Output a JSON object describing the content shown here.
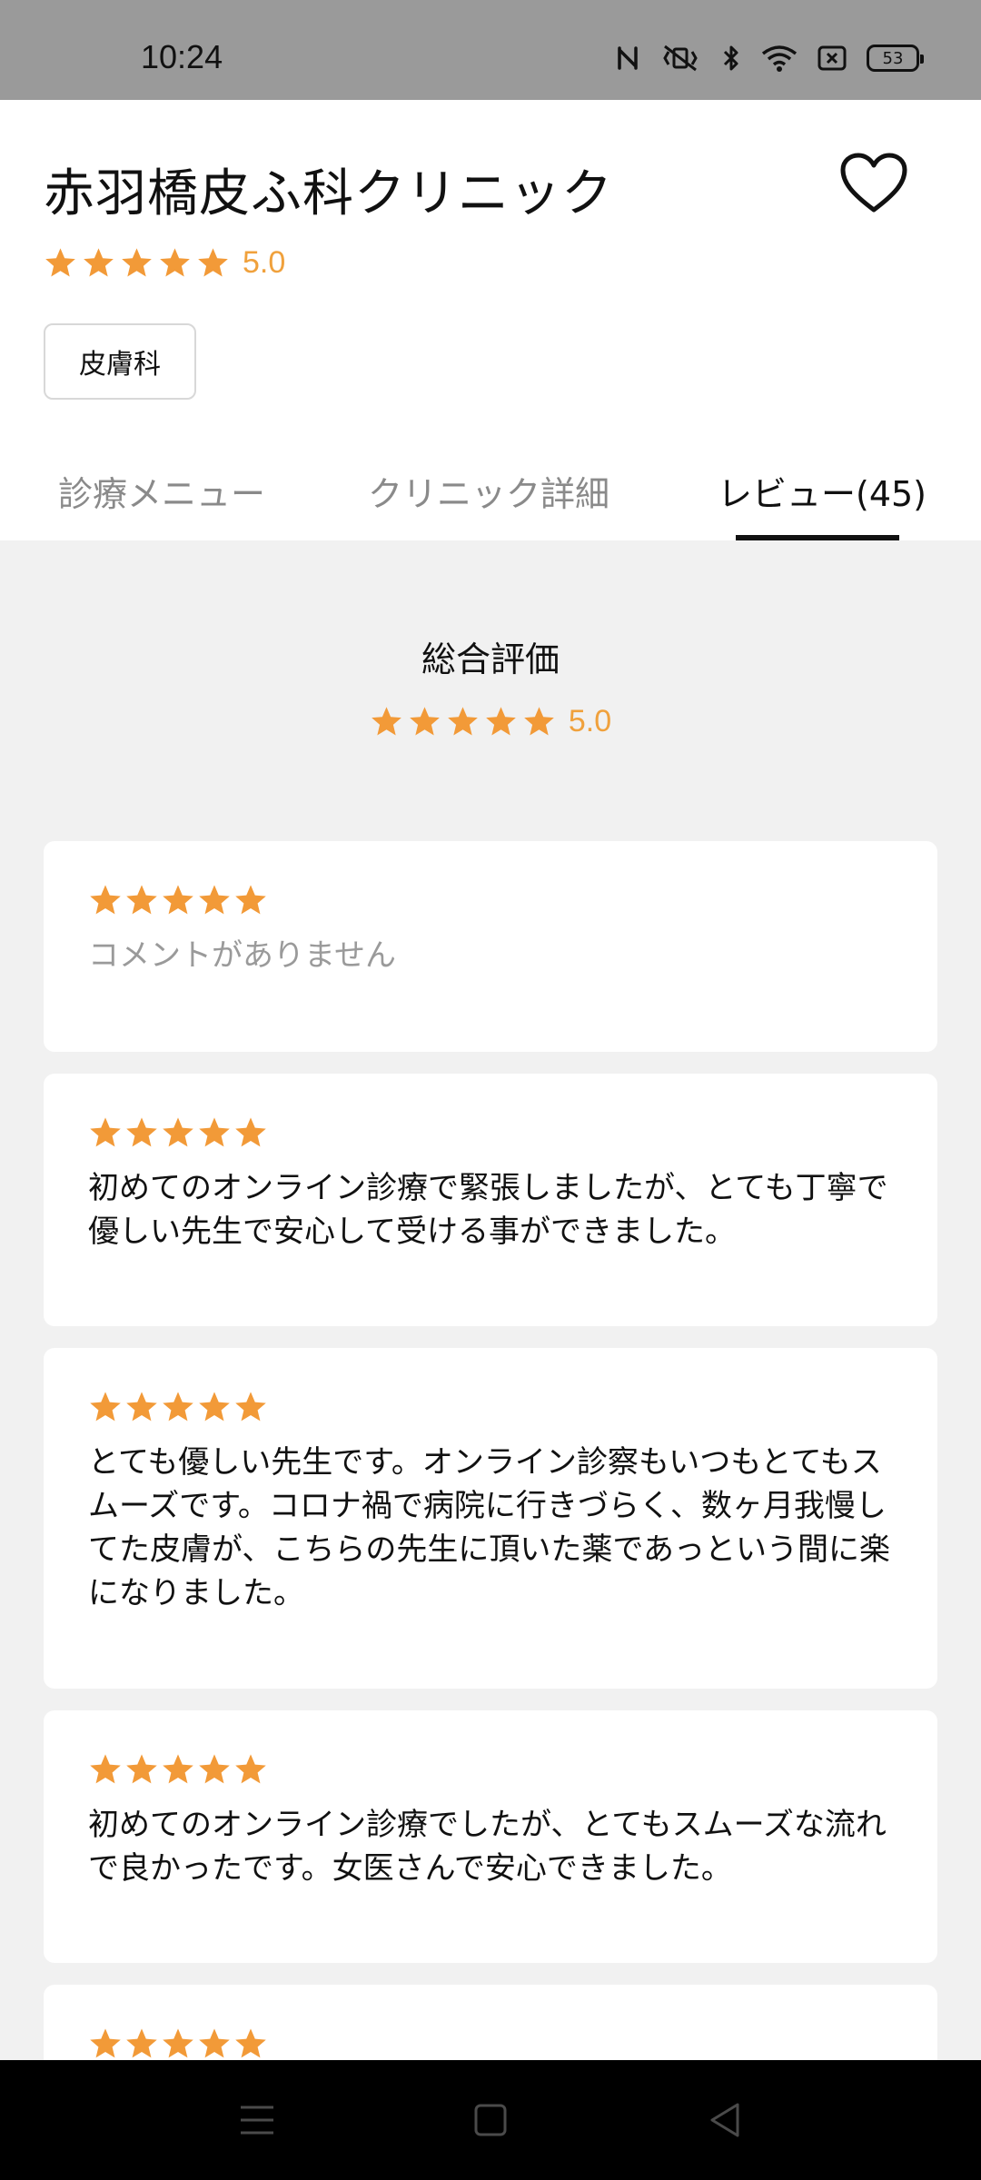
{
  "status_bar": {
    "time": "10:24",
    "battery": "53",
    "icons": [
      "nfc-icon",
      "vibrate-icon",
      "bluetooth-icon",
      "wifi-icon",
      "sim-off-icon",
      "battery-icon"
    ]
  },
  "clinic": {
    "name": "赤羽橋皮ふ科クリニック",
    "rating": 5.0,
    "rating_label": "5.0",
    "tag": "皮膚科",
    "favorite_icon": "heart-outline-icon"
  },
  "tabs": [
    {
      "label": "診療メニュー",
      "active": false
    },
    {
      "label": "クリニック詳細",
      "active": false
    },
    {
      "label": "レビュー(45)",
      "active": true
    }
  ],
  "overall": {
    "title": "総合評価",
    "rating": 5.0,
    "rating_label": "5.0"
  },
  "reviews": [
    {
      "stars": 5,
      "text": "コメントがありません"
    },
    {
      "stars": 5,
      "text": "初めてのオンライン診療で緊張しましたが、とても丁寧で優しい先生で安心して受ける事ができました。"
    },
    {
      "stars": 5,
      "text": "とても優しい先生です。オンライン診察もいつもとてもスムーズです。コロナ禍で病院に行きづらく、数ヶ月我慢してた皮膚が、こちらの先生に頂いた薬であっという間に楽になりました。"
    },
    {
      "stars": 5,
      "text": "初めてのオンライン診療でしたが、とてもスムーズな流れで良かったです。女医さんで安心できました。"
    },
    {
      "stars": 5,
      "text": ""
    }
  ],
  "colors": {
    "star": "#f29a38",
    "rating_text": "#f0a13c",
    "status_bar": "#9a9a9a",
    "background": "#f1f1f1",
    "nav_bar": "#000000"
  },
  "nav_bar": {
    "icons": [
      "menu-icon",
      "home-icon",
      "back-icon"
    ]
  }
}
